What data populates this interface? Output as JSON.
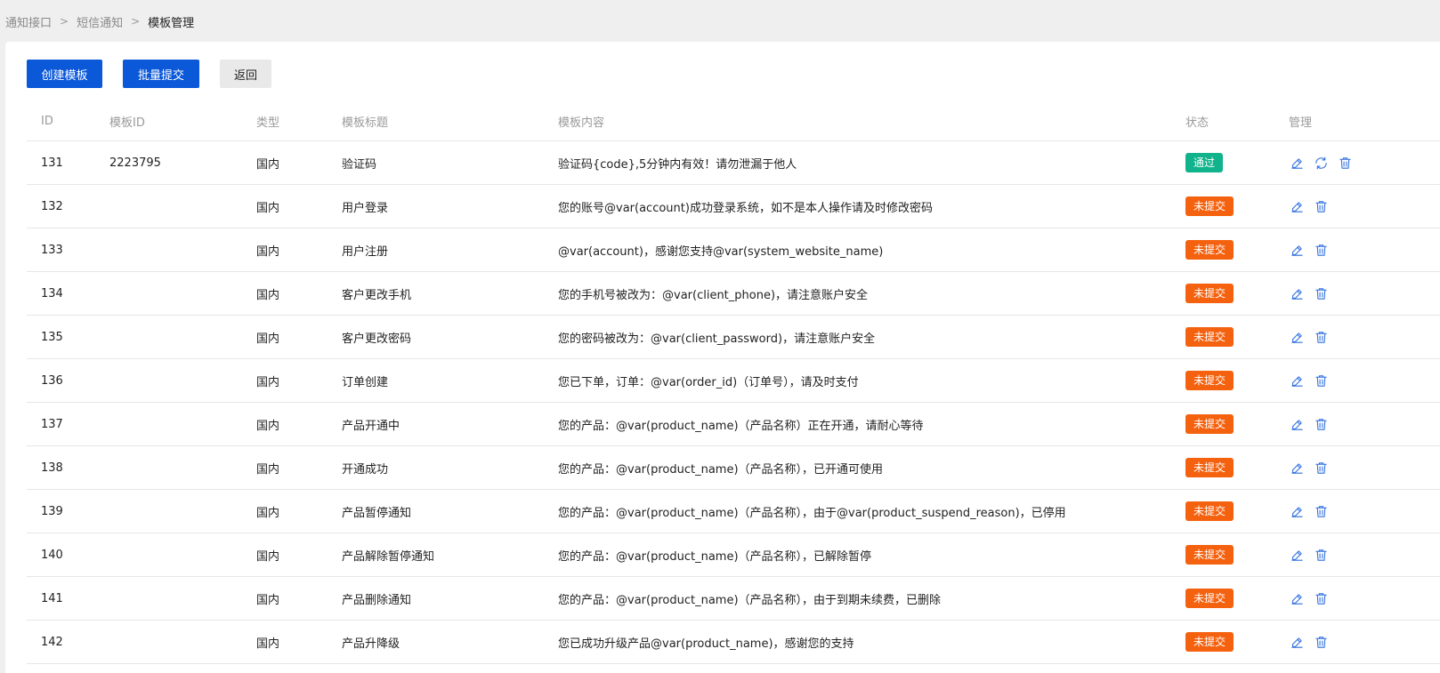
{
  "breadcrumb": [
    "通知接口",
    "短信通知",
    "模板管理"
  ],
  "toolbar": {
    "create_label": "创建模板",
    "batch_label": "批量提交",
    "back_label": "返回"
  },
  "table": {
    "headers": {
      "id": "ID",
      "template_id": "模板ID",
      "type": "类型",
      "title": "模板标题",
      "content": "模板内容",
      "status": "状态",
      "manage": "管理"
    },
    "rows": [
      {
        "id": "131",
        "template_id": "2223795",
        "type": "国内",
        "title": "验证码",
        "content": "验证码{code},5分钟内有效！请勿泄漏于他人",
        "status": "通过",
        "status_kind": "pass"
      },
      {
        "id": "132",
        "template_id": "",
        "type": "国内",
        "title": "用户登录",
        "content": "您的账号@var(account)成功登录系统，如不是本人操作请及时修改密码",
        "status": "未提交",
        "status_kind": "unsub"
      },
      {
        "id": "133",
        "template_id": "",
        "type": "国内",
        "title": "用户注册",
        "content": "@var(account)，感谢您支持@var(system_website_name)",
        "status": "未提交",
        "status_kind": "unsub"
      },
      {
        "id": "134",
        "template_id": "",
        "type": "国内",
        "title": "客户更改手机",
        "content": "您的手机号被改为：@var(client_phone)，请注意账户安全",
        "status": "未提交",
        "status_kind": "unsub"
      },
      {
        "id": "135",
        "template_id": "",
        "type": "国内",
        "title": "客户更改密码",
        "content": "您的密码被改为：@var(client_password)，请注意账户安全",
        "status": "未提交",
        "status_kind": "unsub"
      },
      {
        "id": "136",
        "template_id": "",
        "type": "国内",
        "title": "订单创建",
        "content": "您已下单，订单：@var(order_id)（订单号），请及时支付",
        "status": "未提交",
        "status_kind": "unsub"
      },
      {
        "id": "137",
        "template_id": "",
        "type": "国内",
        "title": "产品开通中",
        "content": "您的产品：@var(product_name)（产品名称）正在开通，请耐心等待",
        "status": "未提交",
        "status_kind": "unsub"
      },
      {
        "id": "138",
        "template_id": "",
        "type": "国内",
        "title": "开通成功",
        "content": "您的产品：@var(product_name)（产品名称），已开通可使用",
        "status": "未提交",
        "status_kind": "unsub"
      },
      {
        "id": "139",
        "template_id": "",
        "type": "国内",
        "title": "产品暂停通知",
        "content": "您的产品：@var(product_name)（产品名称），由于@var(product_suspend_reason)，已停用",
        "status": "未提交",
        "status_kind": "unsub"
      },
      {
        "id": "140",
        "template_id": "",
        "type": "国内",
        "title": "产品解除暂停通知",
        "content": "您的产品：@var(product_name)（产品名称），已解除暂停",
        "status": "未提交",
        "status_kind": "unsub"
      },
      {
        "id": "141",
        "template_id": "",
        "type": "国内",
        "title": "产品删除通知",
        "content": "您的产品：@var(product_name)（产品名称），由于到期未续费，已删除",
        "status": "未提交",
        "status_kind": "unsub"
      },
      {
        "id": "142",
        "template_id": "",
        "type": "国内",
        "title": "产品升降级",
        "content": "您已成功升级产品@var(product_name)，感谢您的支持",
        "status": "未提交",
        "status_kind": "unsub"
      }
    ]
  },
  "icons": {
    "edit": "edit-icon",
    "sync": "sync-icon",
    "delete": "delete-icon"
  },
  "colors": {
    "primary": "#0b58d9",
    "pass": "#10b38b",
    "unsubmitted": "#f5620f",
    "icon": "#2f6fde"
  }
}
